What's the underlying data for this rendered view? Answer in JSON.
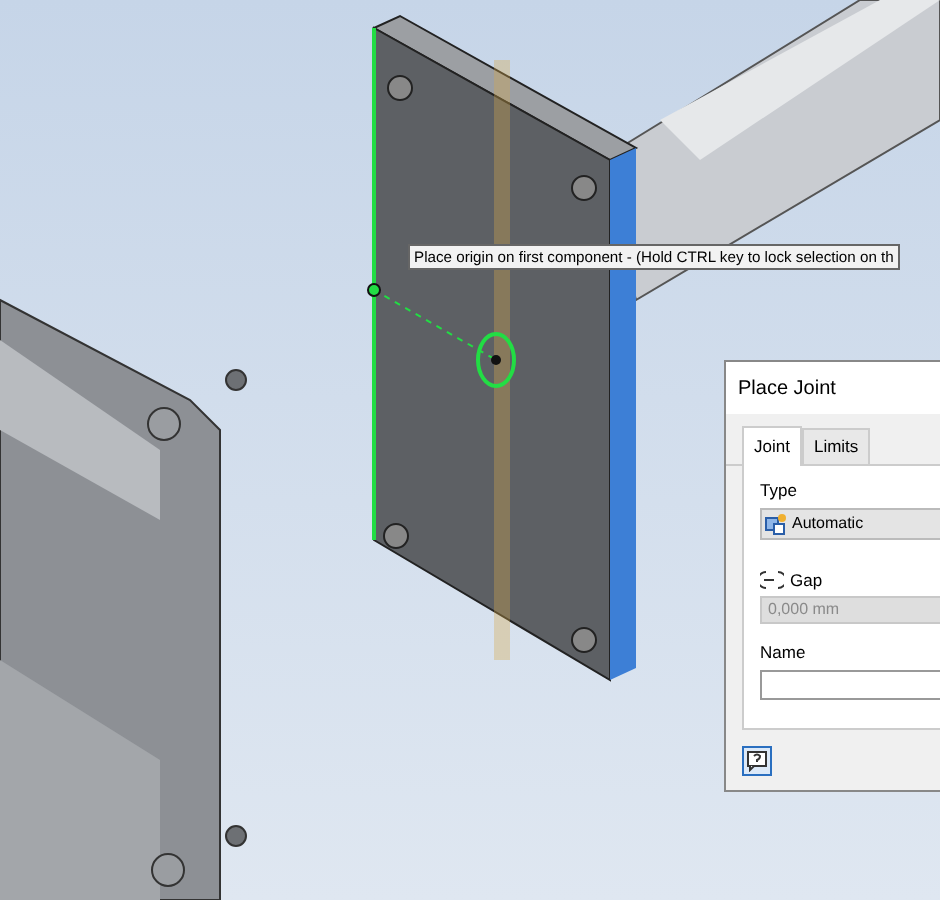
{
  "viewport": {
    "tooltip": "Place origin on first component - (Hold CTRL key to lock selection on th"
  },
  "dialog": {
    "title": "Place Joint",
    "tabs": [
      {
        "label": "Joint",
        "selected": true
      },
      {
        "label": "Limits",
        "selected": false
      }
    ],
    "type": {
      "label": "Type",
      "value": "Automatic"
    },
    "gap": {
      "label": "Gap",
      "value": "0,000 mm",
      "disabled": true
    },
    "name": {
      "label": "Name"
    }
  }
}
